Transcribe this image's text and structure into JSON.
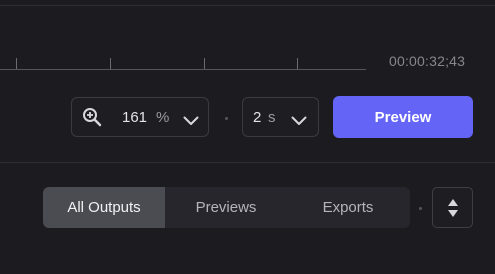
{
  "timeline": {
    "timecode": "00:00:32;43"
  },
  "zoom": {
    "value": "161",
    "unit": "%",
    "icon": "zoom-in-icon"
  },
  "duration": {
    "value": "2",
    "unit": "s"
  },
  "actions": {
    "preview_label": "Preview",
    "accent_color": "#6464f6"
  },
  "outputs": {
    "tabs": [
      {
        "label": "All Outputs",
        "selected": true
      },
      {
        "label": "Previews",
        "selected": false
      },
      {
        "label": "Exports",
        "selected": false
      }
    ],
    "sort_icon": "sort-up-down-icon"
  }
}
